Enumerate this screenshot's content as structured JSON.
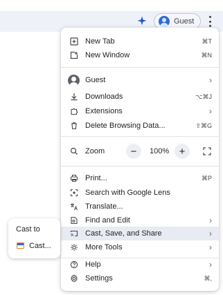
{
  "toolbar": {
    "extensions_icon": "puzzle-icon",
    "profile_label": "Guest",
    "menu_icon": "kebab-icon"
  },
  "menu": {
    "new_tab": {
      "label": "New Tab",
      "shortcut": "⌘T"
    },
    "new_window": {
      "label": "New Window",
      "shortcut": "⌘N"
    },
    "profile": {
      "label": "Guest",
      "chevron": "›"
    },
    "downloads": {
      "label": "Downloads",
      "shortcut": "⌥⌘J"
    },
    "extensions": {
      "label": "Extensions",
      "chevron": "›"
    },
    "delete_browsing_data": {
      "label": "Delete Browsing Data...",
      "shortcut": "⇧⌘G"
    },
    "zoom": {
      "label": "Zoom",
      "minus": "−",
      "value": "100%",
      "plus": "+"
    },
    "print": {
      "label": "Print...",
      "shortcut": "⌘P"
    },
    "search_lens": {
      "label": "Search with Google Lens"
    },
    "translate": {
      "label": "Translate..."
    },
    "find_edit": {
      "label": "Find and Edit",
      "chevron": "›"
    },
    "cast_save_share": {
      "label": "Cast, Save, and Share",
      "chevron": "›"
    },
    "more_tools": {
      "label": "More Tools",
      "chevron": "›"
    },
    "help": {
      "label": "Help",
      "chevron": "›"
    },
    "settings": {
      "label": "Settings",
      "shortcut": "⌘,"
    }
  },
  "submenu": {
    "title": "Cast to",
    "items": [
      {
        "label": "Cast..."
      }
    ]
  },
  "colors": {
    "accent": "#1a57d6",
    "highlight": "#e8ebf2"
  }
}
